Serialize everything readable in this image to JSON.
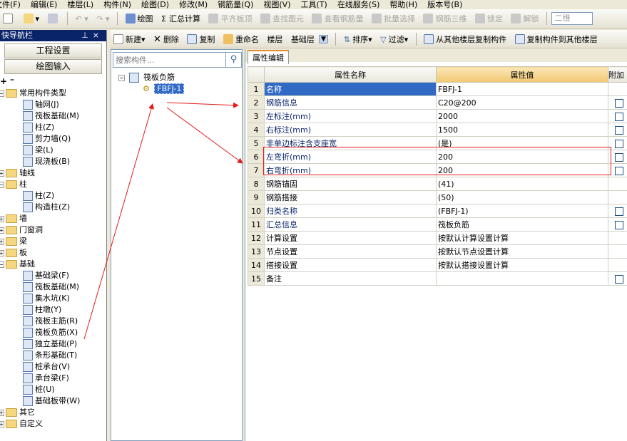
{
  "menu": [
    "文件(F)",
    "编辑(E)",
    "楼层(L)",
    "构件(N)",
    "绘图(D)",
    "修改(M)",
    "钢筋量(Q)",
    "视图(V)",
    "工具(T)",
    "在线服务(S)",
    "帮助(H)",
    "版本号(B)"
  ],
  "toolbar1": {
    "draw": "绘图",
    "sum_calc": "汇总计算",
    "flush_top": "平齐板顶",
    "find_element": "查找图元",
    "view_rebar": "查看钢筋量",
    "batch_select": "批量选择",
    "rebar_3d": "钢筋三维",
    "lock": "锁定",
    "unlock": "解锁",
    "view_mode": "二维"
  },
  "nav": {
    "title": "快导航栏",
    "project_settings": "工程设置",
    "drawing_input": "绘图输入",
    "tree": [
      {
        "label": "常用构件类型",
        "type": "folder",
        "expanded": true
      },
      {
        "label": "轴网(J)",
        "type": "item"
      },
      {
        "label": "筏板基础(M)",
        "type": "item"
      },
      {
        "label": "柱(Z)",
        "type": "item"
      },
      {
        "label": "剪力墙(Q)",
        "type": "item"
      },
      {
        "label": "梁(L)",
        "type": "item"
      },
      {
        "label": "现浇板(B)",
        "type": "item"
      },
      {
        "label": "轴线",
        "type": "folder",
        "expanded": false
      },
      {
        "label": "柱",
        "type": "folder",
        "expanded": true
      },
      {
        "label": "柱(Z)",
        "type": "item"
      },
      {
        "label": "构造柱(Z)",
        "type": "item"
      },
      {
        "label": "墙",
        "type": "folder",
        "expanded": false
      },
      {
        "label": "门窗洞",
        "type": "folder",
        "expanded": false
      },
      {
        "label": "梁",
        "type": "folder",
        "expanded": false
      },
      {
        "label": "板",
        "type": "folder",
        "expanded": false
      },
      {
        "label": "基础",
        "type": "folder",
        "expanded": true
      },
      {
        "label": "基础梁(F)",
        "type": "item"
      },
      {
        "label": "筏板基础(M)",
        "type": "item"
      },
      {
        "label": "集水坑(K)",
        "type": "item"
      },
      {
        "label": "柱墩(Y)",
        "type": "item"
      },
      {
        "label": "筏板主筋(R)",
        "type": "item"
      },
      {
        "label": "筏板负筋(X)",
        "type": "item"
      },
      {
        "label": "独立基础(P)",
        "type": "item"
      },
      {
        "label": "条形基础(T)",
        "type": "item"
      },
      {
        "label": "桩承台(V)",
        "type": "item"
      },
      {
        "label": "承台梁(F)",
        "type": "item"
      },
      {
        "label": "桩(U)",
        "type": "item"
      },
      {
        "label": "基础板带(W)",
        "type": "item"
      },
      {
        "label": "其它",
        "type": "folder",
        "expanded": false
      },
      {
        "label": "自定义",
        "type": "folder",
        "expanded": false
      }
    ]
  },
  "toolbar2": {
    "new": "新建",
    "delete": "删除",
    "copy": "复制",
    "rename": "重命名",
    "floor_label": "楼层",
    "floor_value": "基础层",
    "sort": "排序",
    "filter": "过滤",
    "copy_from_other": "从其他楼层复制构件",
    "copy_to_other": "复制构件到其他楼层"
  },
  "component_tree": {
    "search_placeholder": "搜索构件...",
    "root": "筏板负筋",
    "child": "FBFJ-1"
  },
  "property_panel": {
    "tab": "属性编辑",
    "columns": [
      "属性名称",
      "属性值",
      "附加"
    ],
    "rows": [
      {
        "n": "1",
        "name": "名称",
        "value": "FBFJ-1",
        "checkbox": false
      },
      {
        "n": "2",
        "name": "钢筋信息",
        "value": "C20@200",
        "checkbox": true
      },
      {
        "n": "3",
        "name": "左标注(mm)",
        "value": "2000",
        "checkbox": true
      },
      {
        "n": "4",
        "name": "右标注(mm)",
        "value": "1500",
        "checkbox": true
      },
      {
        "n": "5",
        "name": "非单边标注含支座宽",
        "value": "(是)",
        "checkbox": true
      },
      {
        "n": "6",
        "name": "左弯折(mm)",
        "value": "200",
        "checkbox": true
      },
      {
        "n": "7",
        "name": "右弯折(mm)",
        "value": "200",
        "checkbox": true
      },
      {
        "n": "8",
        "name": "钢筋锚固",
        "value": "(41)",
        "checkbox": false
      },
      {
        "n": "9",
        "name": "钢筋搭接",
        "value": "(50)",
        "checkbox": false
      },
      {
        "n": "10",
        "name": "归类名称",
        "value": "(FBFJ-1)",
        "checkbox": true
      },
      {
        "n": "11",
        "name": "汇总信息",
        "value": "筏板负筋",
        "checkbox": true
      },
      {
        "n": "12",
        "name": "计算设置",
        "value": "按默认计算设置计算",
        "checkbox": false
      },
      {
        "n": "13",
        "name": "节点设置",
        "value": "按默认节点设置计算",
        "checkbox": false
      },
      {
        "n": "14",
        "name": "搭接设置",
        "value": "按默认搭接设置计算",
        "checkbox": false
      },
      {
        "n": "15",
        "name": "备注",
        "value": "",
        "checkbox": true
      }
    ]
  },
  "colors": {
    "accent": "#316ac5",
    "nav_title": "#0a246a",
    "annotation": "#e31b1b",
    "header_value": "#f2c871"
  }
}
